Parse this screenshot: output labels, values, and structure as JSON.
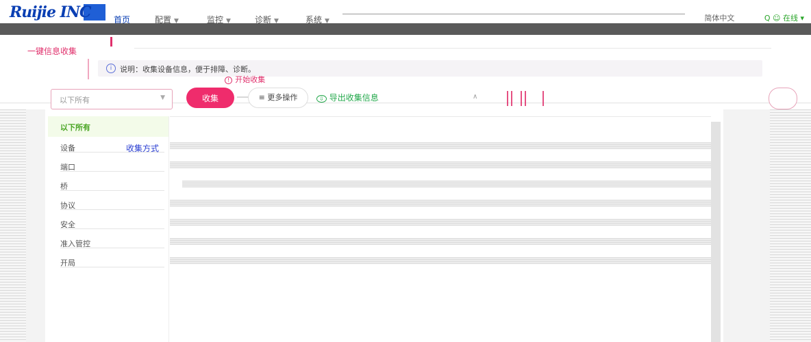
{
  "header": {
    "logo_text": "Ruijie INC",
    "nav": [
      {
        "label": "首页",
        "active": true
      },
      {
        "label": "配置",
        "active": false
      },
      {
        "label": "监控",
        "active": false
      },
      {
        "label": "诊断",
        "active": false
      },
      {
        "label": "系统",
        "active": false
      }
    ],
    "language": "简体中文",
    "right_tools": "Q  ☺ 在线 ▾"
  },
  "page": {
    "tab_label": "一键信息收集"
  },
  "notice": {
    "icon": "info-icon",
    "text": "说明：收集设备信息，便于排障、诊断。"
  },
  "actions": {
    "start_collect": "开始收集",
    "select_placeholder": "以下所有",
    "collect_button": "收集",
    "more_button": "更多操作",
    "export_link": "导出收集信息"
  },
  "tree": {
    "header": "以下所有",
    "items": [
      "设备",
      "端口",
      "桥",
      "协议",
      "安全",
      "准入管控",
      "开局"
    ],
    "tooltip": "收集方式"
  },
  "colors": {
    "accent": "#ef2c6c",
    "brand": "#0a3fb3",
    "success": "#23a84b"
  }
}
